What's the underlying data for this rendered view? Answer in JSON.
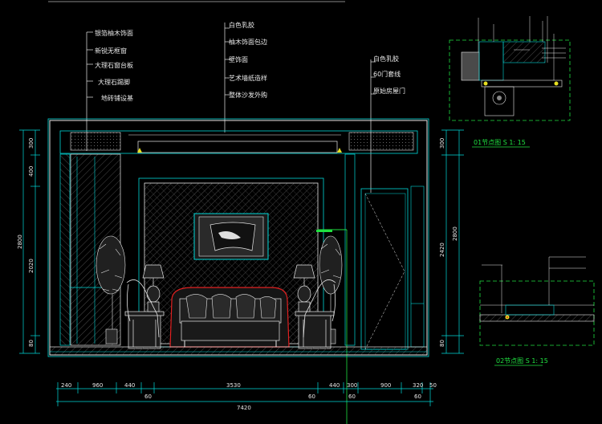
{
  "labels_left": [
    "银箔柚木饰面",
    "新锐无框窗",
    "大理石窗台板",
    "大理石踢脚",
    "地砖铺设基"
  ],
  "labels_center": [
    "白色乳胶",
    "柚木饰面包边",
    "壁饰面",
    "艺术墙纸造样",
    "整体沙发外购"
  ],
  "labels_right": [
    "白色乳胶",
    "60门套线",
    "原始房屋门"
  ],
  "dims_left": [
    "300",
    "400",
    "2800",
    "2020",
    "80"
  ],
  "dims_right": [
    "300",
    "2800",
    "2420",
    "80"
  ],
  "dims_bottom": [
    "240",
    "960",
    "440",
    "3530",
    "440",
    "300",
    "900",
    "320",
    "50"
  ],
  "dims_bottom_sub": [
    "60",
    "60",
    "60",
    "60"
  ],
  "dim_total": "7420",
  "detail_top_caption": "01节点图 S 1: 15",
  "detail_bottom_caption": "02节点图 S 1: 15",
  "colors": {
    "cyan": "#00d8d8",
    "green": "#20e040",
    "red": "#e02020",
    "white": "#e8e8e8",
    "yellow": "#e8e020"
  }
}
